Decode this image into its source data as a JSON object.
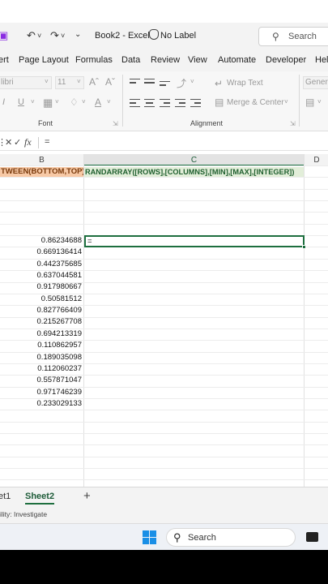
{
  "titlebar": {
    "title": "Book2 - Excel",
    "label": "No Label",
    "search": "Search"
  },
  "menu": {
    "tabs": [
      "ert",
      "Page Layout",
      "Formulas",
      "Data",
      "Review",
      "View",
      "Automate",
      "Developer",
      "Hel"
    ]
  },
  "ribbon": {
    "font_name": "libri",
    "font_size": "11",
    "wrap_text": "Wrap Text",
    "merge_center": "Merge & Center",
    "number_format": "Genera",
    "font_group": "Font",
    "alignment_group": "Alignment"
  },
  "formula_bar": {
    "fx": "fx",
    "content": "="
  },
  "columns": [
    "B",
    "C",
    "D"
  ],
  "header_row": {
    "b": "TWEEN(BOTTOM,TOP)",
    "c": "RANDARRAY([ROWS],[COLUMNS],[MIN],[MAX],[INTEGER])"
  },
  "values": [
    "0.86234688",
    "0.669136414",
    "0.442375685",
    "0.637044581",
    "0.917980667",
    "0.50581512",
    "0.827766409",
    "0.215267708",
    "0.694213319",
    "0.110862957",
    "0.189035098",
    "0.112060237",
    "0.557871047",
    "0.971746239",
    "0.233029133"
  ],
  "active_cell_text": "=",
  "sheets": {
    "sheet1": "et1",
    "sheet2": "Sheet2"
  },
  "status": "ility: Investigate",
  "taskbar": {
    "search": "Search"
  },
  "colors": {
    "accent": "#217346",
    "header_b_bg": "#f7c9a6",
    "header_c_bg": "#e2eed9"
  }
}
